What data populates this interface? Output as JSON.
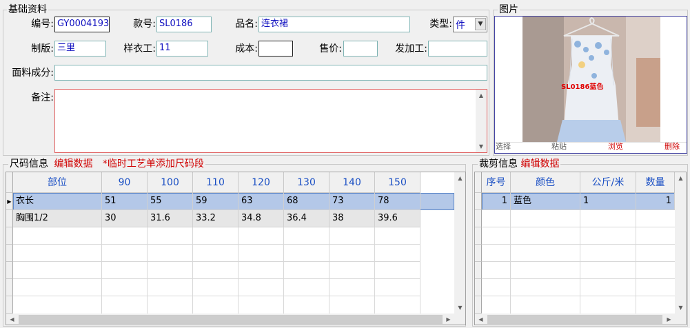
{
  "basic": {
    "title": "基础资料",
    "fields": {
      "code_label": "编号:",
      "code_value": "GY0004193",
      "style_label": "款号:",
      "style_value": "SL0186",
      "name_label": "品名:",
      "name_value": "连衣裙",
      "type_label": "类型:",
      "type_value": "件",
      "plate_label": "制版:",
      "plate_value": "三里",
      "sample_label": "样衣工:",
      "sample_value": "11",
      "cost_label": "成本:",
      "cost_value": "",
      "price_label": "售价:",
      "price_value": "",
      "process_label": "发加工:",
      "process_value": "",
      "fabric_label": "面料成分:",
      "fabric_value": "",
      "remark_label": "备注:",
      "remark_value": ""
    }
  },
  "picture": {
    "title": "图片",
    "overlay_text": "SL0186蓝色",
    "buttons": {
      "select": "选择",
      "paste": "粘贴",
      "browse": "浏览",
      "delete": "删除"
    }
  },
  "size_info": {
    "title": "尺码信息",
    "edit_link": "编辑数据",
    "note": "*临时工艺单添加尺码段",
    "columns": [
      "部位",
      "90",
      "100",
      "110",
      "120",
      "130",
      "140",
      "150"
    ],
    "rows": [
      [
        "衣长",
        "51",
        "55",
        "59",
        "63",
        "68",
        "73",
        "78"
      ],
      [
        "胸围1/2",
        "30",
        "31.6",
        "33.2",
        "34.8",
        "36.4",
        "38",
        "39.6"
      ]
    ]
  },
  "cut_info": {
    "title": "裁剪信息",
    "edit_link": "编辑数据",
    "columns": [
      "序号",
      "颜色",
      "公斤/米",
      "数量"
    ],
    "rows": [
      [
        "1",
        "蓝色",
        "1",
        "1"
      ]
    ]
  },
  "colors": {
    "accent_blue": "#1010c0",
    "header_blue": "#1a4fc4",
    "red": "#d00000",
    "selected_row": "#b4c8e8"
  }
}
